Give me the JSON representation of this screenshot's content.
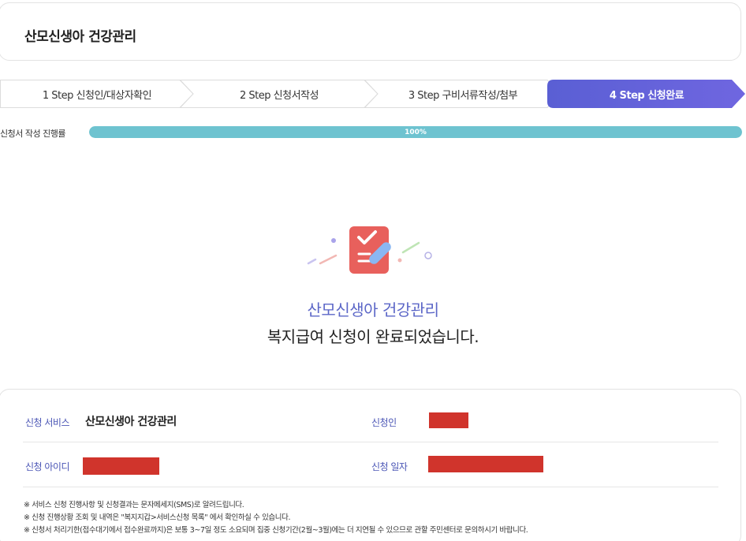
{
  "header": {
    "title": "산모신생아 건강관리"
  },
  "steps": [
    {
      "label": "1 Step 신청인/대상자확인",
      "active": false
    },
    {
      "label": "2 Step 신청서작성",
      "active": false
    },
    {
      "label": "3 Step 구비서류작성/첨부",
      "active": false
    },
    {
      "label": "4 Step 신청완료",
      "active": true
    }
  ],
  "progress": {
    "label": "신청서 작성 진행률",
    "percent_text": "100%",
    "value": 100
  },
  "illustration": {
    "icon": "checklist-pencil-icon"
  },
  "completion": {
    "service_name": "산모신생아 건강관리",
    "message": "복지급여 신청이 완료되었습니다."
  },
  "info": {
    "service_label": "신청 서비스",
    "service_value": "산모신생아 건강관리",
    "applicant_label": "신청인",
    "id_label": "신청 아이디",
    "date_label": "신청 일자"
  },
  "notes": [
    "※ 서비스 신청 진행사항 및 신청결과는 문자메세지(SMS)로 알려드립니다.",
    "※ 신청 진행상황 조회 및 내역은 \"복지지갑>서비스신청 목록\" 에서 확인하실 수 있습니다.",
    "※ 신청서 처리기한(접수대기에서 접수완료까지)은 보통 3~7일 정도 소요되며 집중 신청기간(2월~3월)에는 더 지연될 수 있으므로 관할 주민센터로 문의하시기 바랍니다."
  ],
  "colors": {
    "accent": "#5b66c7",
    "step_active": "#5e63d8",
    "progress_fill": "#6ec3d0",
    "redaction": "#d0342c"
  }
}
